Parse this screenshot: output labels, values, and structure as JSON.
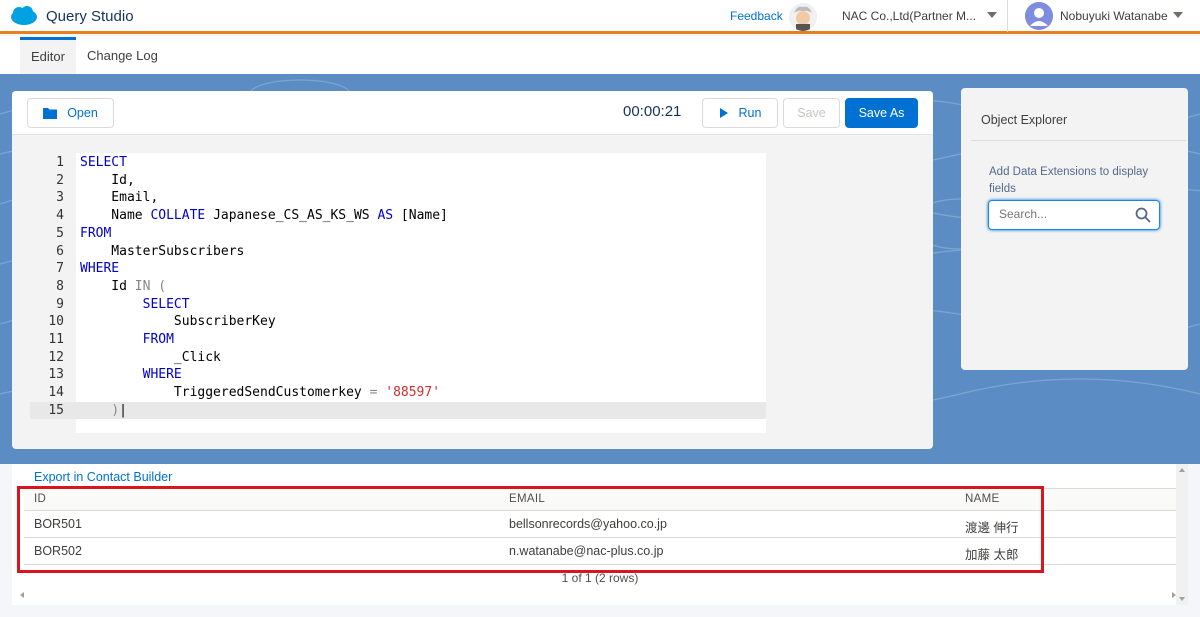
{
  "app": {
    "title": "Query Studio"
  },
  "header": {
    "feedback_label": "Feedback",
    "org_name": "NAC Co.,Ltd(Partner M...",
    "user_name": "Nobuyuki Watanabe"
  },
  "tabs": [
    {
      "label": "Editor",
      "active": true
    },
    {
      "label": "Change Log",
      "active": false
    }
  ],
  "toolbar": {
    "open_label": "Open",
    "timer": "00:00:21",
    "run_label": "Run",
    "save_label": "Save",
    "save_as_label": "Save As"
  },
  "editor": {
    "line_numbers": [
      "1",
      "2",
      "3",
      "4",
      "5",
      "6",
      "7",
      "8",
      "9",
      "10",
      "11",
      "12",
      "13",
      "14",
      "15"
    ],
    "active_line": "15"
  },
  "explorer": {
    "title": "Object Explorer",
    "help_text": "Add Data Extensions to display fields",
    "search_placeholder": "Search..."
  },
  "results": {
    "export_label": "Export in Contact Builder",
    "columns": [
      "ID",
      "EMAIL",
      "NAME"
    ],
    "rows": [
      {
        "id": "BOR501",
        "email": "bellsonrecords@yahoo.co.jp",
        "name": "渡邊 伸行"
      },
      {
        "id": "BOR502",
        "email": "n.watanabe@nac-plus.co.jp",
        "name": "加藤 太郎"
      }
    ],
    "pager_text": "1 of 1 (2 rows)"
  },
  "colors": {
    "brand_blue": "#0070d2",
    "header_accent": "#e6801e",
    "highlight_red": "#d9161f"
  },
  "icons": [
    "salesforce-cloud-icon",
    "einstein-avatar-icon",
    "user-avatar-icon",
    "folder-icon",
    "play-icon",
    "search-icon",
    "chevron-down-icon"
  ]
}
